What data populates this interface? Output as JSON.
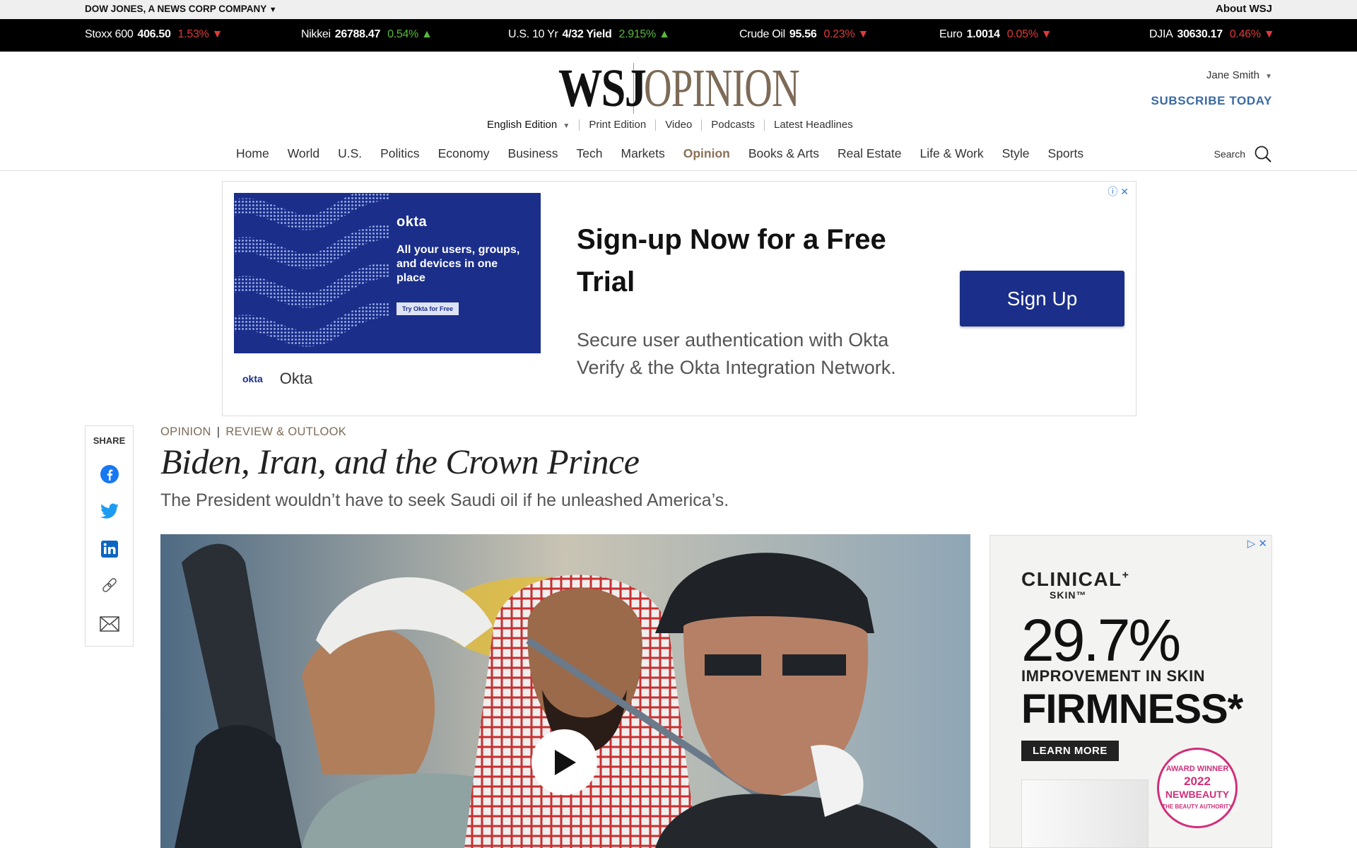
{
  "topbar": {
    "company": "DOW JONES, A NEWS CORP COMPANY",
    "company_arrow": "▼",
    "about": "About WSJ"
  },
  "ticker": [
    {
      "name": "Stoxx 600",
      "value": "406.50",
      "change": "1.53%",
      "dir": "down",
      "arrow": "▼"
    },
    {
      "name": "Nikkei",
      "value": "26788.47",
      "change": "0.54%",
      "dir": "up",
      "arrow": "▲"
    },
    {
      "name": "U.S. 10 Yr",
      "value": "4/32 Yield",
      "change": "2.915%",
      "dir": "up",
      "arrow": "▲"
    },
    {
      "name": "Crude Oil",
      "value": "95.56",
      "change": "0.23%",
      "dir": "down",
      "arrow": "▼"
    },
    {
      "name": "Euro",
      "value": "1.0014",
      "change": "0.05%",
      "dir": "down",
      "arrow": "▼"
    },
    {
      "name": "DJIA",
      "value": "30630.17",
      "change": "0.46%",
      "dir": "down",
      "arrow": "▼"
    }
  ],
  "masthead": {
    "logo_left": "WSJ",
    "logo_right": "OPINION"
  },
  "editions": {
    "edition": "English Edition",
    "edition_arrow": "▼",
    "links": [
      "Print Edition",
      "Video",
      "Podcasts",
      "Latest Headlines"
    ]
  },
  "account": {
    "user": "Jane Smith",
    "user_arrow": "▼",
    "subscribe": "SUBSCRIBE TODAY"
  },
  "nav": {
    "items": [
      "Home",
      "World",
      "U.S.",
      "Politics",
      "Economy",
      "Business",
      "Tech",
      "Markets",
      "Opinion",
      "Books & Arts",
      "Real Estate",
      "Life & Work",
      "Style",
      "Sports"
    ],
    "active": "Opinion",
    "search_label": "Search"
  },
  "ad_top": {
    "image_brand": "okta",
    "image_tagline": "All your users, groups, and devices in one place",
    "image_cta": "Try Okta for Free",
    "advertiser_logo": "okta",
    "advertiser_name": "Okta",
    "headline": "Sign-up Now for a Free Trial",
    "description": "Secure user authentication with Okta Verify & the Okta Integration Network.",
    "button": "Sign Up",
    "choice_icons": "ⓘ ✕"
  },
  "share": {
    "label": "SHARE",
    "icons": [
      "facebook-icon",
      "twitter-icon",
      "linkedin-icon",
      "link-icon",
      "email-icon"
    ]
  },
  "article": {
    "section": "OPINION",
    "separator": "|",
    "column": "REVIEW & OUTLOOK",
    "headline": "Biden, Iran, and the Crown Prince",
    "dek": "The President wouldn’t have to seek Saudi oil if he unleashed America’s."
  },
  "ad_side": {
    "brand": "CLINICAL",
    "brand_plus": "+",
    "brand_sub": "SKIN™",
    "stat": "29.7%",
    "line1": "IMPROVEMENT IN SKIN",
    "line2": "FIRMNESS*",
    "cta": "LEARN MORE",
    "seal_top": "AWARD WINNER",
    "seal_year": "2022",
    "seal_name": "NEWBEAUTY",
    "seal_bottom": "THE BEAUTY AUTHORITY",
    "choice_icons": "▷ ✕"
  },
  "colors": {
    "accent": "#7d6b57",
    "down": "#e03a3a",
    "up": "#57b93c",
    "okta_blue": "#1a2e8a",
    "subscribe": "#3a6aa3"
  }
}
